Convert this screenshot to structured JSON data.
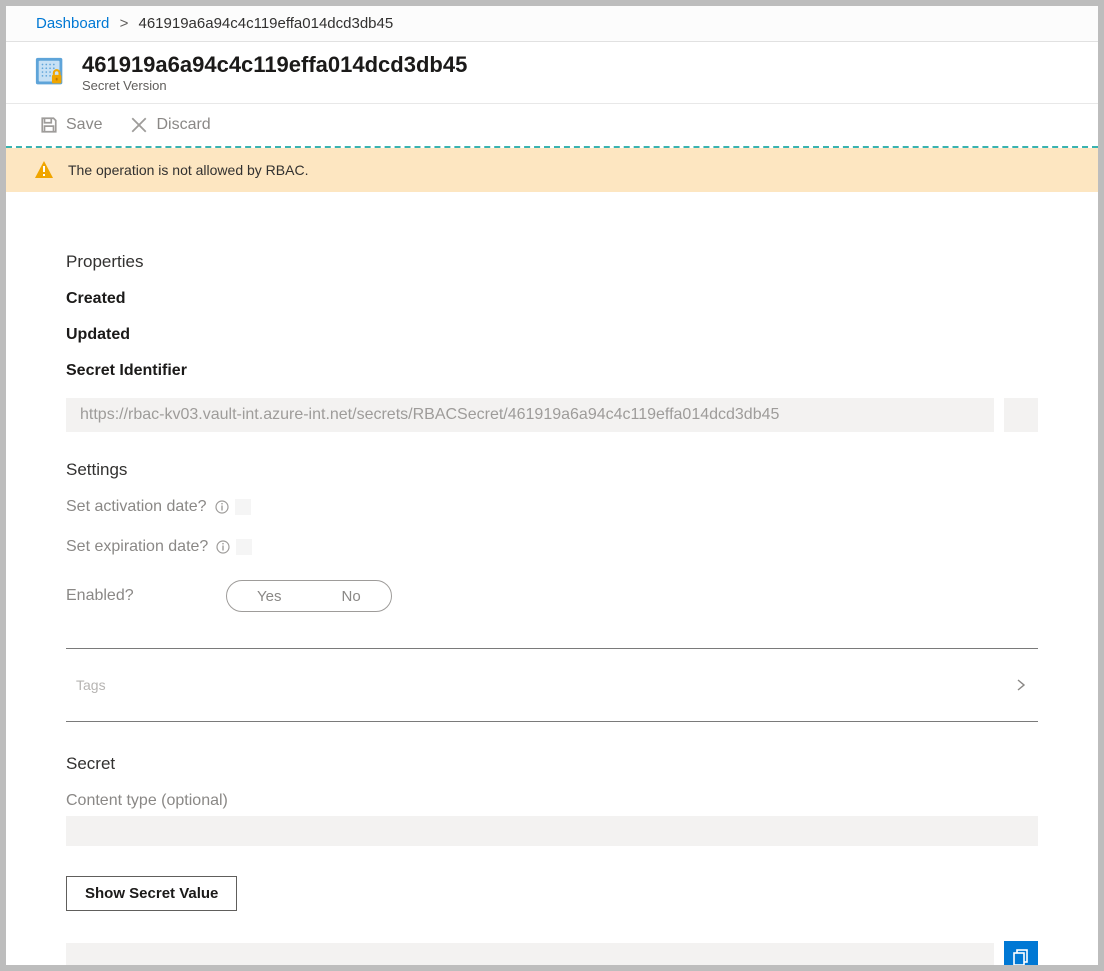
{
  "breadcrumb": {
    "root": "Dashboard",
    "separator": ">",
    "current": "461919a6a94c4c119effa014dcd3db45"
  },
  "header": {
    "title": "461919a6a94c4c119effa014dcd3db45",
    "subtitle": "Secret Version"
  },
  "toolbar": {
    "save": "Save",
    "discard": "Discard"
  },
  "warning": {
    "message": "The operation is not allowed by RBAC."
  },
  "properties": {
    "heading": "Properties",
    "created_label": "Created",
    "updated_label": "Updated",
    "secret_identifier_label": "Secret Identifier",
    "secret_identifier_value": "https://rbac-kv03.vault-int.azure-int.net/secrets/RBACSecret/461919a6a94c4c119effa014dcd3db45"
  },
  "settings": {
    "heading": "Settings",
    "activation_label": "Set activation date?",
    "expiration_label": "Set expiration date?",
    "enabled_label": "Enabled?",
    "yes": "Yes",
    "no": "No",
    "tags_label": "Tags"
  },
  "secret": {
    "heading": "Secret",
    "content_type_label": "Content type (optional)",
    "content_type_value": "",
    "show_button": "Show Secret Value",
    "value": ""
  }
}
